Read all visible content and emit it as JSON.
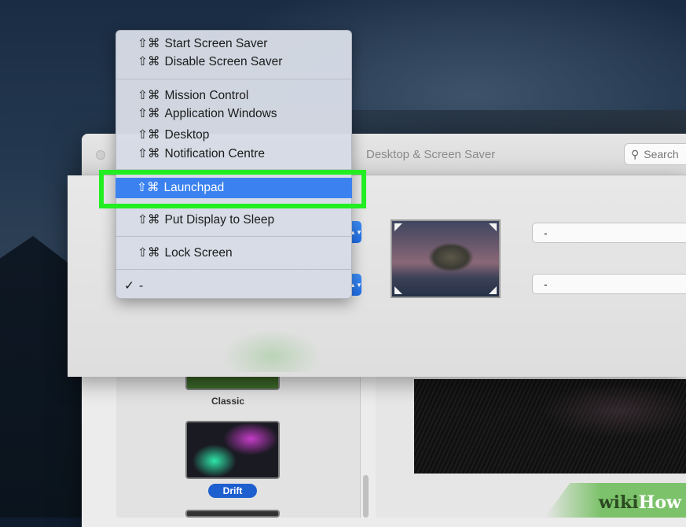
{
  "window": {
    "title": "Desktop & Screen Saver",
    "search_placeholder": "Search"
  },
  "hot_corner_menu": {
    "groups": [
      [
        {
          "modifiers": "⇧⌘",
          "label": "Start Screen Saver"
        },
        {
          "modifiers": "⇧⌘",
          "label": "Disable Screen Saver"
        }
      ],
      [
        {
          "modifiers": "⇧⌘",
          "label": "Mission Control"
        },
        {
          "modifiers": "⇧⌘",
          "label": "Application Windows"
        },
        {
          "modifiers": "⇧⌘",
          "label": "Desktop"
        },
        {
          "modifiers": "⇧⌘",
          "label": "Notification Centre"
        }
      ],
      [
        {
          "modifiers": "⇧⌘",
          "label": "Launchpad",
          "highlighted": true
        }
      ],
      [
        {
          "modifiers": "⇧⌘",
          "label": "Put Display to Sleep"
        }
      ],
      [
        {
          "modifiers": "⇧⌘",
          "label": "Lock Screen"
        }
      ],
      [
        {
          "checked": true,
          "check_glyph": "✓",
          "label": "-"
        }
      ]
    ],
    "highlight_color": "#3b82f0",
    "callout_color": "#22ee22"
  },
  "hot_corners": {
    "top_right_value": "-",
    "bottom_right_value": "-"
  },
  "screen_savers": [
    {
      "label": "Classic",
      "selected": false
    },
    {
      "label": "Drift",
      "selected": true
    }
  ],
  "watermark": {
    "wiki": "wiki",
    "how": "How"
  }
}
